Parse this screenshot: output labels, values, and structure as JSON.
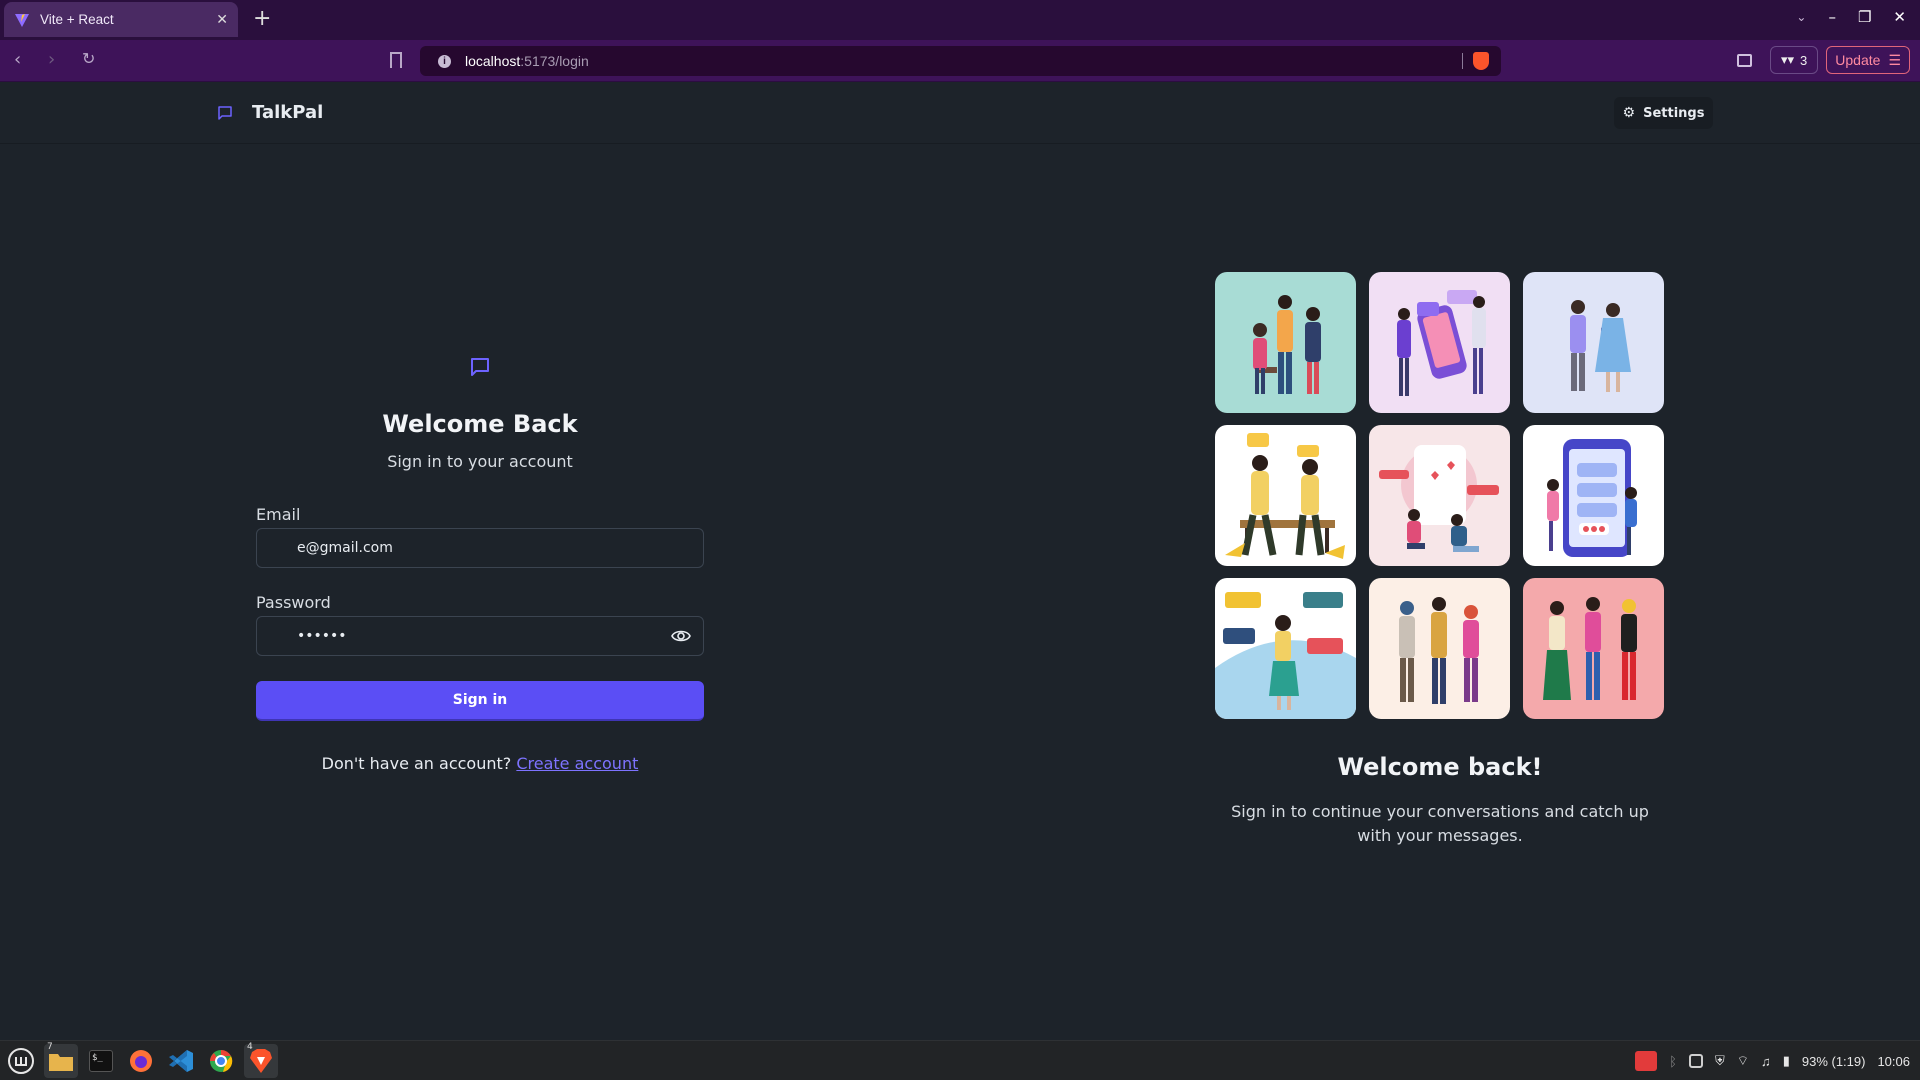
{
  "browser": {
    "tab_title": "Vite + React",
    "url_host": "localhost",
    "url_path": ":5173/login",
    "wallet_count": "3",
    "update_label": "Update"
  },
  "app": {
    "brand": "TalkPal",
    "settings_label": "Settings"
  },
  "login": {
    "title": "Welcome Back",
    "subtitle": "Sign in to your account",
    "email_label": "Email",
    "email_value": "e@gmail.com",
    "password_label": "Password",
    "password_value": "••••••",
    "signin_label": "Sign in",
    "signup_prompt": "Don't have an account?",
    "signup_link": "Create account"
  },
  "promo": {
    "title": "Welcome back!",
    "subtitle": "Sign in to continue your conversations and catch up with your messages.",
    "tiles": [
      {
        "bg": "#a8dcd5"
      },
      {
        "bg": "#f1dff4"
      },
      {
        "bg": "#dfe4f7"
      },
      {
        "bg": "#ffffff"
      },
      {
        "bg": "#f7e6e8"
      },
      {
        "bg": "#ffffff"
      },
      {
        "bg": "#ffffff"
      },
      {
        "bg": "#fcefe6"
      },
      {
        "bg": "#f4a9ab"
      }
    ]
  },
  "taskbar": {
    "files_badge": "7",
    "brave_badge": "4",
    "battery": "93% (1:19)",
    "clock": "10:06"
  },
  "colors": {
    "accent": "#5b4ef5",
    "link": "#7d73ff",
    "background": "#1d232a"
  }
}
